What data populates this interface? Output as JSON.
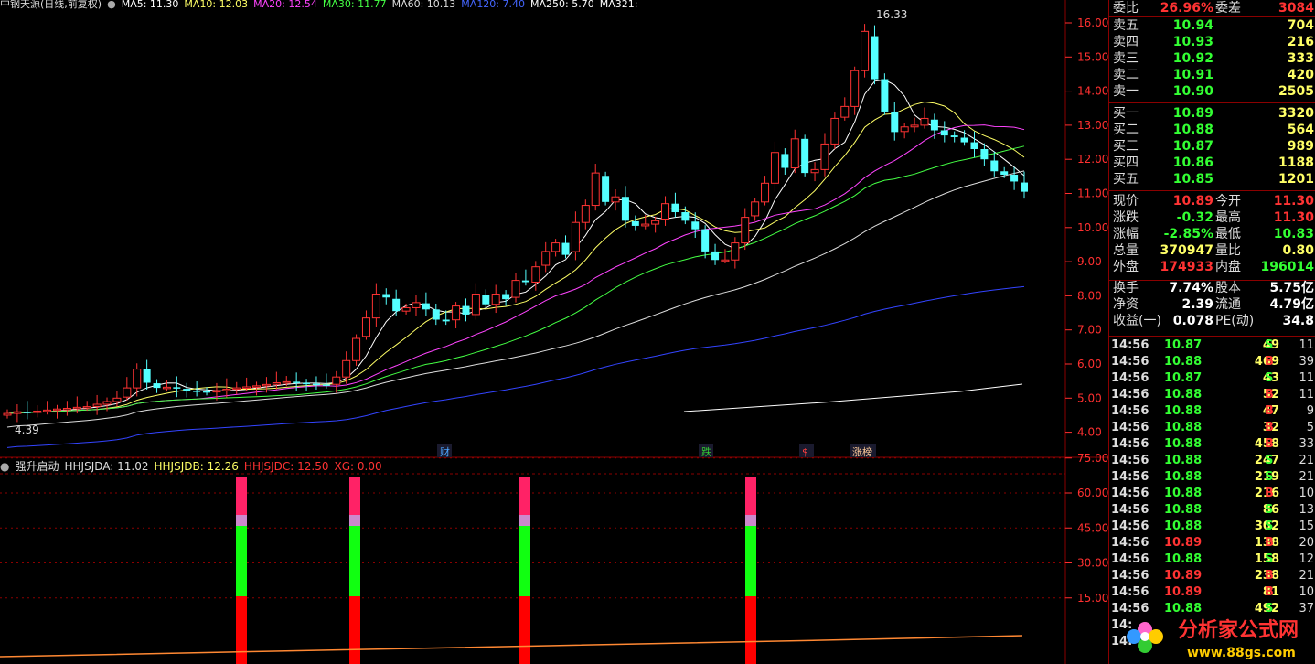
{
  "header": {
    "stock": "中钢天源(日线,前复权)",
    "ma": [
      {
        "label": "MA5: 11.30",
        "color": "#ffffff"
      },
      {
        "label": "MA10: 12.03",
        "color": "#ffff66"
      },
      {
        "label": "MA20: 12.54",
        "color": "#ff44ff"
      },
      {
        "label": "MA30: 11.77",
        "color": "#44ff44"
      },
      {
        "label": "MA60: 10.13",
        "color": "#dddddd"
      },
      {
        "label": "MA120: 7.40",
        "color": "#4466ff"
      },
      {
        "label": "MA250: 5.70",
        "color": "#ffffff"
      },
      {
        "label": "MA321:",
        "color": "#ffffff"
      }
    ]
  },
  "price_axis": [
    "16.00",
    "15.00",
    "14.00",
    "13.00",
    "12.00",
    "11.00",
    "10.00",
    "9.00",
    "8.00",
    "7.00",
    "6.00",
    "5.00",
    "4.00"
  ],
  "annotations": {
    "high": "16.33",
    "low": "4.39"
  },
  "event_tags": [
    {
      "label": "财",
      "color": "#4da6ff"
    },
    {
      "label": "跌",
      "color": "#33cc33"
    },
    {
      "label": "$",
      "color": "#ff4040"
    },
    {
      "label": "涨榜",
      "color": "#ffcc99"
    }
  ],
  "indicator": {
    "name": "强升启动",
    "values": [
      {
        "label": "HHJSJDA: 11.02",
        "color": "#dddddd"
      },
      {
        "label": "HHJSJDB: 12.26",
        "color": "#ffff66"
      },
      {
        "label": "HHJSJDC: 12.50",
        "color": "#ff3333"
      },
      {
        "label": "XG: 0.00",
        "color": "#ff3333"
      }
    ],
    "axis": [
      "75.00",
      "60.00",
      "45.00",
      "30.00",
      "15.00"
    ]
  },
  "quote": {
    "ratio": {
      "l1": "委比",
      "v1": "26.96%",
      "l2": "委差",
      "v2": "3084"
    },
    "asks": [
      {
        "label": "卖五",
        "price": "10.94",
        "vol": "704"
      },
      {
        "label": "卖四",
        "price": "10.93",
        "vol": "216"
      },
      {
        "label": "卖三",
        "price": "10.92",
        "vol": "333"
      },
      {
        "label": "卖二",
        "price": "10.91",
        "vol": "420"
      },
      {
        "label": "卖一",
        "price": "10.90",
        "vol": "2505"
      }
    ],
    "bids": [
      {
        "label": "买一",
        "price": "10.89",
        "vol": "3320"
      },
      {
        "label": "买二",
        "price": "10.88",
        "vol": "564"
      },
      {
        "label": "买三",
        "price": "10.87",
        "vol": "989"
      },
      {
        "label": "买四",
        "price": "10.86",
        "vol": "1188"
      },
      {
        "label": "买五",
        "price": "10.85",
        "vol": "1201"
      }
    ],
    "stats": [
      {
        "l1": "现价",
        "v1": "10.89",
        "c1": "#ff3333",
        "l2": "今开",
        "v2": "11.30",
        "c2": "#ff3333"
      },
      {
        "l1": "涨跌",
        "v1": "-0.32",
        "c1": "#33ff33",
        "l2": "最高",
        "v2": "11.30",
        "c2": "#ff3333"
      },
      {
        "l1": "涨幅",
        "v1": "-2.85%",
        "c1": "#33ff33",
        "l2": "最低",
        "v2": "10.83",
        "c2": "#33ff33"
      },
      {
        "l1": "总量",
        "v1": "370947",
        "c1": "#ffff66",
        "l2": "量比",
        "v2": "0.80",
        "c2": "#ffff66"
      },
      {
        "l1": "外盘",
        "v1": "174933",
        "c1": "#ff3333",
        "l2": "内盘",
        "v2": "196014",
        "c2": "#33ff33"
      },
      {
        "l1": "换手",
        "v1": "7.74%",
        "c1": "#ffffff",
        "l2": "股本",
        "v2": "5.75亿",
        "c2": "#ffffff"
      },
      {
        "l1": "净资",
        "v1": "2.39",
        "c1": "#ffffff",
        "l2": "流通",
        "v2": "4.79亿",
        "c2": "#ffffff"
      },
      {
        "l1": "收益(一)",
        "v1": "0.078",
        "c1": "#ffffff",
        "l2": "PE(动)",
        "v2": "34.8",
        "c2": "#ffffff"
      }
    ],
    "ticks": [
      {
        "t": "14:56",
        "p": "10.87",
        "v": "49",
        "s": "S",
        "n": "11"
      },
      {
        "t": "14:56",
        "p": "10.88",
        "v": "469",
        "s": "B",
        "n": "39"
      },
      {
        "t": "14:56",
        "p": "10.87",
        "v": "43",
        "s": "S",
        "n": "11"
      },
      {
        "t": "14:56",
        "p": "10.88",
        "v": "52",
        "s": "B",
        "n": "11"
      },
      {
        "t": "14:56",
        "p": "10.88",
        "v": "47",
        "s": "B",
        "n": "9"
      },
      {
        "t": "14:56",
        "p": "10.88",
        "v": "32",
        "s": "B",
        "n": "5"
      },
      {
        "t": "14:56",
        "p": "10.88",
        "v": "458",
        "s": "B",
        "n": "33"
      },
      {
        "t": "14:56",
        "p": "10.88",
        "v": "247",
        "s": "S",
        "n": "21"
      },
      {
        "t": "14:56",
        "p": "10.88",
        "v": "219",
        "s": "S",
        "n": "21"
      },
      {
        "t": "14:56",
        "p": "10.88",
        "v": "216",
        "s": "B",
        "n": "10"
      },
      {
        "t": "14:56",
        "p": "10.88",
        "v": "86",
        "s": "S",
        "n": "13"
      },
      {
        "t": "14:56",
        "p": "10.88",
        "v": "302",
        "s": "S",
        "n": "15"
      },
      {
        "t": "14:56",
        "p": "10.89",
        "v": "138",
        "s": "B",
        "n": "20"
      },
      {
        "t": "14:56",
        "p": "10.88",
        "v": "158",
        "s": "S",
        "n": "12"
      },
      {
        "t": "14:56",
        "p": "10.89",
        "v": "238",
        "s": "B",
        "n": "21"
      },
      {
        "t": "14:56",
        "p": "10.89",
        "v": "81",
        "s": "B",
        "n": "10"
      },
      {
        "t": "14:56",
        "p": "10.88",
        "v": "492",
        "s": "S",
        "n": "37"
      },
      {
        "t": "14:",
        "p": "",
        "v": "",
        "s": "",
        "n": ""
      },
      {
        "t": "14:",
        "p": "",
        "v": "",
        "s": "",
        "n": ""
      }
    ]
  },
  "watermark": {
    "title": "分析家公式网",
    "url": "www.88gs.com"
  },
  "colors": {
    "up": "#ff3333",
    "down": "#54ffff",
    "grid": "#8b0000"
  }
}
